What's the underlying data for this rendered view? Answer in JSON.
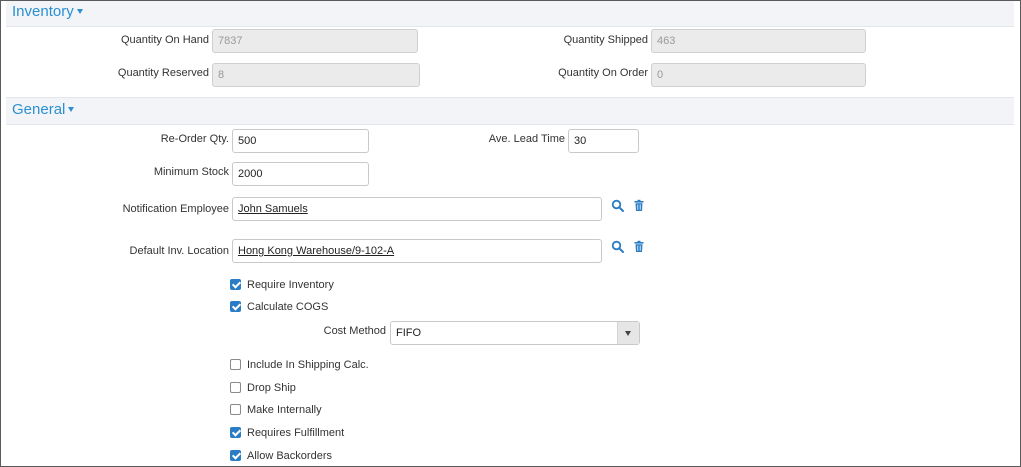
{
  "sections": {
    "inventory": {
      "title": "Inventory"
    },
    "general": {
      "title": "General"
    }
  },
  "inventory": {
    "quantity_on_hand": {
      "label": "Quantity On Hand",
      "value": "7837"
    },
    "quantity_shipped": {
      "label": "Quantity Shipped",
      "value": "463"
    },
    "quantity_reserved": {
      "label": "Quantity Reserved",
      "value": "8"
    },
    "quantity_on_order": {
      "label": "Quantity On Order",
      "value": "0"
    }
  },
  "general": {
    "reorder_qty": {
      "label": "Re-Order Qty.",
      "value": "500"
    },
    "ave_lead_time": {
      "label": "Ave. Lead Time",
      "value": "30"
    },
    "minimum_stock": {
      "label": "Minimum Stock",
      "value": "2000"
    },
    "notification_employee": {
      "label": "Notification Employee",
      "value": "John Samuels"
    },
    "default_inv_location": {
      "label": "Default Inv. Location",
      "value": "Hong Kong Warehouse/9-102-A"
    },
    "cost_method": {
      "label": "Cost Method",
      "value": "FIFO"
    },
    "checkboxes": {
      "require_inventory": {
        "label": "Require Inventory",
        "checked": true
      },
      "calculate_cogs": {
        "label": "Calculate COGS",
        "checked": true
      },
      "include_in_shipping_calc": {
        "label": "Include In Shipping Calc.",
        "checked": false
      },
      "drop_ship": {
        "label": "Drop Ship",
        "checked": false
      },
      "make_internally": {
        "label": "Make Internally",
        "checked": false
      },
      "requires_fulfillment": {
        "label": "Requires Fulfillment",
        "checked": true
      },
      "allow_backorders": {
        "label": "Allow Backorders",
        "checked": true
      }
    }
  },
  "colors": {
    "accent": "#2b8fd1",
    "checkbox": "#2a7cc4",
    "header_bg": "#f2f4f7"
  },
  "icons": {
    "search": "search-icon",
    "delete": "trash-icon"
  }
}
